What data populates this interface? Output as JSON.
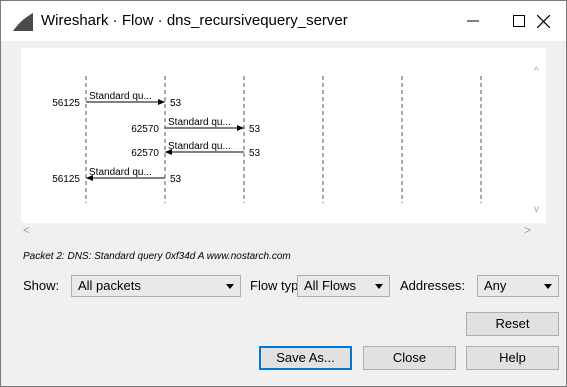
{
  "window": {
    "title": "Wireshark · Flow · dns_recursivequery_server",
    "minimize_icon": "minimize-icon",
    "maximize_icon": "maximize-icon",
    "close_icon": "close-icon"
  },
  "flow": {
    "events": [
      {
        "src_port": "56125",
        "label": "Standard qu...",
        "dst_port": "53",
        "direction": "right",
        "from_col": 0,
        "to_col": 1,
        "port_side": "left"
      },
      {
        "src_port": "62570",
        "label": "Standard qu...",
        "dst_port": "53",
        "direction": "right",
        "from_col": 1,
        "to_col": 2,
        "port_side": "left"
      },
      {
        "src_port": "62570",
        "label": "Standard qu...",
        "dst_port": "53",
        "direction": "left",
        "from_col": 1,
        "to_col": 2,
        "port_side": "left"
      },
      {
        "src_port": "56125",
        "label": "Standard qu...",
        "dst_port": "53",
        "direction": "left",
        "from_col": 0,
        "to_col": 1,
        "port_side": "left"
      }
    ],
    "column_count": 7
  },
  "status_text": "Packet 2: DNS: Standard query 0xf34d A www.nostarch.com",
  "controls": {
    "show_label": "Show:",
    "show_value": "All packets",
    "flow_type_label": "Flow type:",
    "flow_type_value": "All Flows",
    "addresses_label": "Addresses:",
    "addresses_value": "Any"
  },
  "buttons": {
    "reset": "Reset",
    "save_as": "Save As...",
    "close": "Close",
    "help": "Help"
  }
}
